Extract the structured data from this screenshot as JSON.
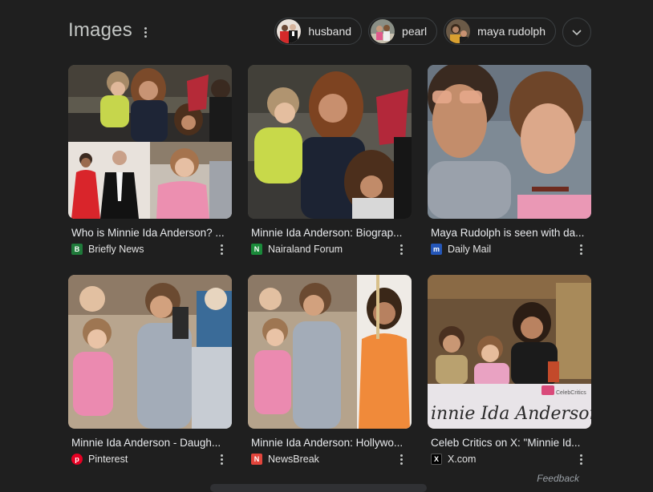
{
  "header": {
    "title": "Images",
    "chips": [
      "husband",
      "pearl",
      "maya rudolph"
    ]
  },
  "cards": [
    {
      "caption": "Who is Minnie Ida Anderson? ...",
      "source": "Briefly News"
    },
    {
      "caption": "Minnie Ida Anderson: Biograp...",
      "source": "Nairaland Forum"
    },
    {
      "caption": "Maya Rudolph is seen with da...",
      "source": "Daily Mail"
    },
    {
      "caption": "Minnie Ida Anderson - Daugh...",
      "source": "Pinterest"
    },
    {
      "caption": "Minnie Ida Anderson: Hollywo...",
      "source": "NewsBreak"
    },
    {
      "caption": "Celeb Critics on X: \"Minnie Id...",
      "source": "X.com"
    }
  ],
  "overlay_text": {
    "card6_script": "innie Ida Anderson",
    "card6_logo": "CelebCritics"
  },
  "favicons": {
    "briefly": "B",
    "nairaland": "N",
    "dailymail": "m",
    "pinterest": "p",
    "newsbreak": "N",
    "x": "X"
  },
  "footer": {
    "feedback": "Feedback"
  },
  "colors": {
    "background": "#1f1f1f",
    "chip_border": "#3c4043",
    "text": "#e8eaed"
  }
}
